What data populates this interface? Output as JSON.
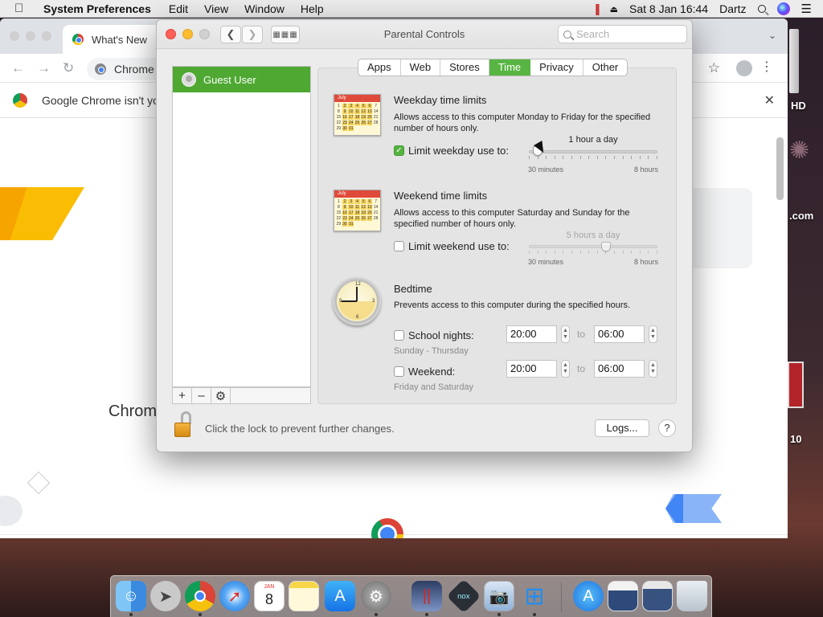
{
  "menubar": {
    "app_name": "System Preferences",
    "menus": [
      "Edit",
      "View",
      "Window",
      "Help"
    ],
    "clock": "Sat 8 Jan  16:44",
    "user": "Dartz"
  },
  "chrome_bg": {
    "tab_title": "What's New",
    "omnibox_text": "Chrome",
    "infobar_text": "Google Chrome isn't yo",
    "page_heading": "Chrom"
  },
  "desktop": {
    "labels": [
      "HD",
      ".com",
      "10"
    ]
  },
  "window": {
    "title": "Parental Controls",
    "search_placeholder": "Search"
  },
  "users": [
    {
      "name": "Guest User",
      "selected": true
    }
  ],
  "tabs": [
    {
      "label": "Apps",
      "active": false
    },
    {
      "label": "Web",
      "active": false
    },
    {
      "label": "Stores",
      "active": false
    },
    {
      "label": "Time",
      "active": true
    },
    {
      "label": "Privacy",
      "active": false
    },
    {
      "label": "Other",
      "active": false
    }
  ],
  "weekday": {
    "title": "Weekday time limits",
    "description": "Allows access to this computer Monday to Friday for the specified number of hours only.",
    "checkbox_label": "Limit weekday use to:",
    "checked": true,
    "value_label": "1 hour a day",
    "min_label": "30 minutes",
    "max_label": "8 hours",
    "value_hours": 1,
    "min_hours": 0.5,
    "max_hours": 8
  },
  "weekend": {
    "title": "Weekend time limits",
    "description": "Allows access to this computer Saturday and Sunday for the specified number of hours only.",
    "checkbox_label": "Limit weekend use to:",
    "checked": false,
    "value_label": "5 hours a day",
    "min_label": "30 minutes",
    "max_label": "8 hours",
    "value_hours": 5,
    "min_hours": 0.5,
    "max_hours": 8
  },
  "bedtime": {
    "title": "Bedtime",
    "description": "Prevents access to this computer during the specified hours.",
    "to_label": "to",
    "school_nights": {
      "label": "School nights:",
      "checked": false,
      "from": "20:00",
      "to": "06:00",
      "sublabel": "Sunday - Thursday"
    },
    "weekend": {
      "label": "Weekend:",
      "checked": false,
      "from": "20:00",
      "to": "06:00",
      "sublabel": "Friday and Saturday"
    }
  },
  "calendar_icon": {
    "month": "July"
  },
  "footer": {
    "lock_text": "Click the lock to prevent further changes.",
    "logs_label": "Logs...",
    "help_label": "?"
  },
  "dock": {
    "calendar_month": "JAN",
    "calendar_day": "8",
    "items": [
      "finder-icon",
      "launchpad-icon",
      "chrome-icon",
      "safari-icon",
      "calendar-icon",
      "notes-icon",
      "app-store-icon",
      "system-preferences-icon",
      "parallels-icon",
      "nox-icon",
      "preview-icon",
      "windows-icon",
      "app-store-downloads-icon",
      "photo-stack-icon",
      "screenshot-icon",
      "trash-icon"
    ]
  },
  "colors": {
    "accent_green": "#4ea832",
    "tab_active": "#58b543",
    "close": "#fe5f57",
    "minimize": "#febc2e"
  }
}
